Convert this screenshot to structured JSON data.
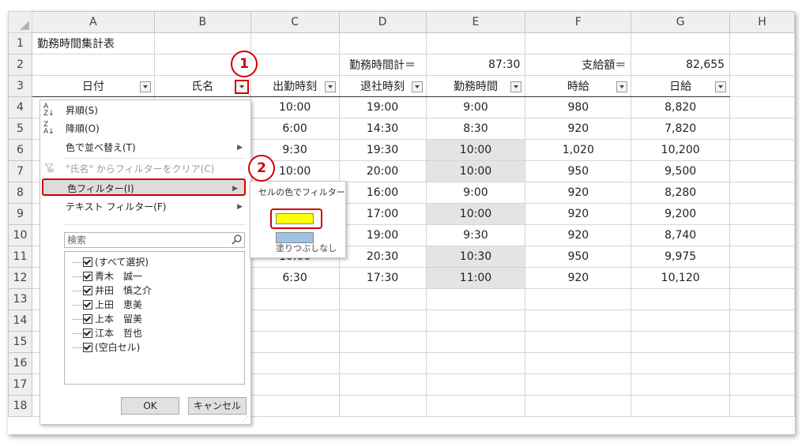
{
  "columns": [
    "A",
    "B",
    "C",
    "D",
    "E",
    "F",
    "G",
    "H"
  ],
  "rows": [
    "1",
    "2",
    "3",
    "4",
    "5",
    "6",
    "7",
    "8",
    "9",
    "10",
    "11",
    "12",
    "13",
    "14",
    "15",
    "16",
    "17",
    "18"
  ],
  "title": "勤務時間集計表",
  "summary": {
    "total_label": "勤務時間計＝",
    "total_value": "87:30",
    "pay_label": "支給額＝",
    "pay_value": "82,655"
  },
  "headers": [
    "日付",
    "氏名",
    "出勤時刻",
    "退社時刻",
    "勤務時間",
    "時給",
    "日給"
  ],
  "data": [
    {
      "in": "10:00",
      "out": "19:00",
      "hours": "9:00",
      "rate": "980",
      "pay": "8,820",
      "gray": false
    },
    {
      "in": "6:00",
      "out": "14:30",
      "hours": "8:30",
      "rate": "920",
      "pay": "7,820",
      "gray": false
    },
    {
      "in": "9:30",
      "out": "19:30",
      "hours": "10:00",
      "rate": "1,020",
      "pay": "10,200",
      "gray": true
    },
    {
      "in": "10:00",
      "out": "20:00",
      "hours": "10:00",
      "rate": "950",
      "pay": "9,500",
      "gray": true
    },
    {
      "in": "",
      "out": "16:00",
      "hours": "9:00",
      "rate": "920",
      "pay": "8,280",
      "gray": false
    },
    {
      "in": "",
      "out": "17:00",
      "hours": "10:00",
      "rate": "920",
      "pay": "9,200",
      "gray": true
    },
    {
      "in": "",
      "out": "19:00",
      "hours": "9:30",
      "rate": "920",
      "pay": "8,740",
      "gray": false
    },
    {
      "in": "10:00",
      "out": "20:30",
      "hours": "10:30",
      "rate": "950",
      "pay": "9,975",
      "gray": true
    },
    {
      "in": "6:30",
      "out": "17:30",
      "hours": "11:00",
      "rate": "920",
      "pay": "10,120",
      "gray": true
    }
  ],
  "menu": {
    "sort_asc": "昇順(S)",
    "sort_desc": "降順(O)",
    "sort_by_color": "色で並べ替え(T)",
    "clear_filter": "\"氏名\" からフィルターをクリア(C)",
    "color_filter": "色フィルター(I)",
    "text_filter": "テキスト フィルター(F)",
    "search_placeholder": "検索",
    "items": [
      "(すべて選択)",
      "青木　誠一",
      "井田　慎之介",
      "上田　恵美",
      "上本　留美",
      "江本　哲也",
      "(空白セル)"
    ],
    "ok": "OK",
    "cancel": "キャンセル"
  },
  "submenu": {
    "title": "セルの色でフィルター",
    "colors": [
      "#ffff00",
      "#9dc3e6"
    ],
    "no_fill": "塗りつぶしなし"
  },
  "markers": [
    "1",
    "2"
  ],
  "accent_color": "#d00000"
}
